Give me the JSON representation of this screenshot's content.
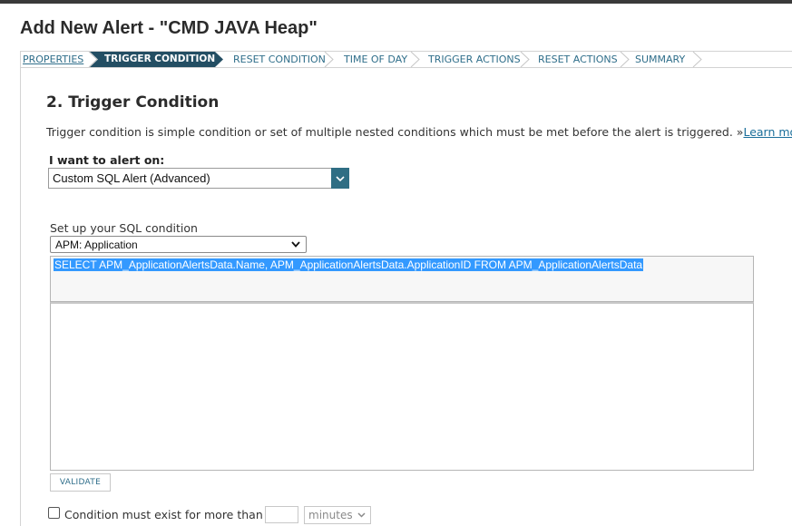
{
  "page": {
    "title": "Add New Alert - \"CMD JAVA Heap\""
  },
  "wizard": {
    "steps": [
      {
        "label": "PROPERTIES",
        "state": "done"
      },
      {
        "label": "TRIGGER CONDITION",
        "state": "active"
      },
      {
        "label": "RESET CONDITION",
        "state": "pending"
      },
      {
        "label": "TIME OF DAY",
        "state": "pending"
      },
      {
        "label": "TRIGGER ACTIONS",
        "state": "pending"
      },
      {
        "label": "RESET ACTIONS",
        "state": "pending"
      },
      {
        "label": "SUMMARY",
        "state": "pending"
      }
    ]
  },
  "section": {
    "title": "2. Trigger Condition",
    "description": "Trigger condition is simple condition or set of multiple nested conditions which must be met before the alert is triggered. »",
    "learn_more": "Learn more"
  },
  "alert_on": {
    "label": "I want to alert on:",
    "selected": "Custom SQL Alert (Advanced)"
  },
  "sql": {
    "label": "Set up your SQL condition",
    "table_selected": "APM: Application",
    "query": "SELECT APM_ApplicationAlertsData.Name, APM_ApplicationAlertsData.ApplicationID FROM APM_ApplicationAlertsData",
    "condition": ""
  },
  "validate_label": "VALIDATE",
  "duration": {
    "label": "Condition must exist for more than",
    "value": "",
    "unit": "minutes",
    "checked": false
  },
  "colors": {
    "active_step_bg": "#234e63",
    "link": "#2f6e8a",
    "selection": "#3399ff",
    "dropdown_button": "#2f6e84"
  },
  "icons": {
    "chevron": "chevron-right-icon",
    "dropdown": "chevron-down-icon"
  }
}
